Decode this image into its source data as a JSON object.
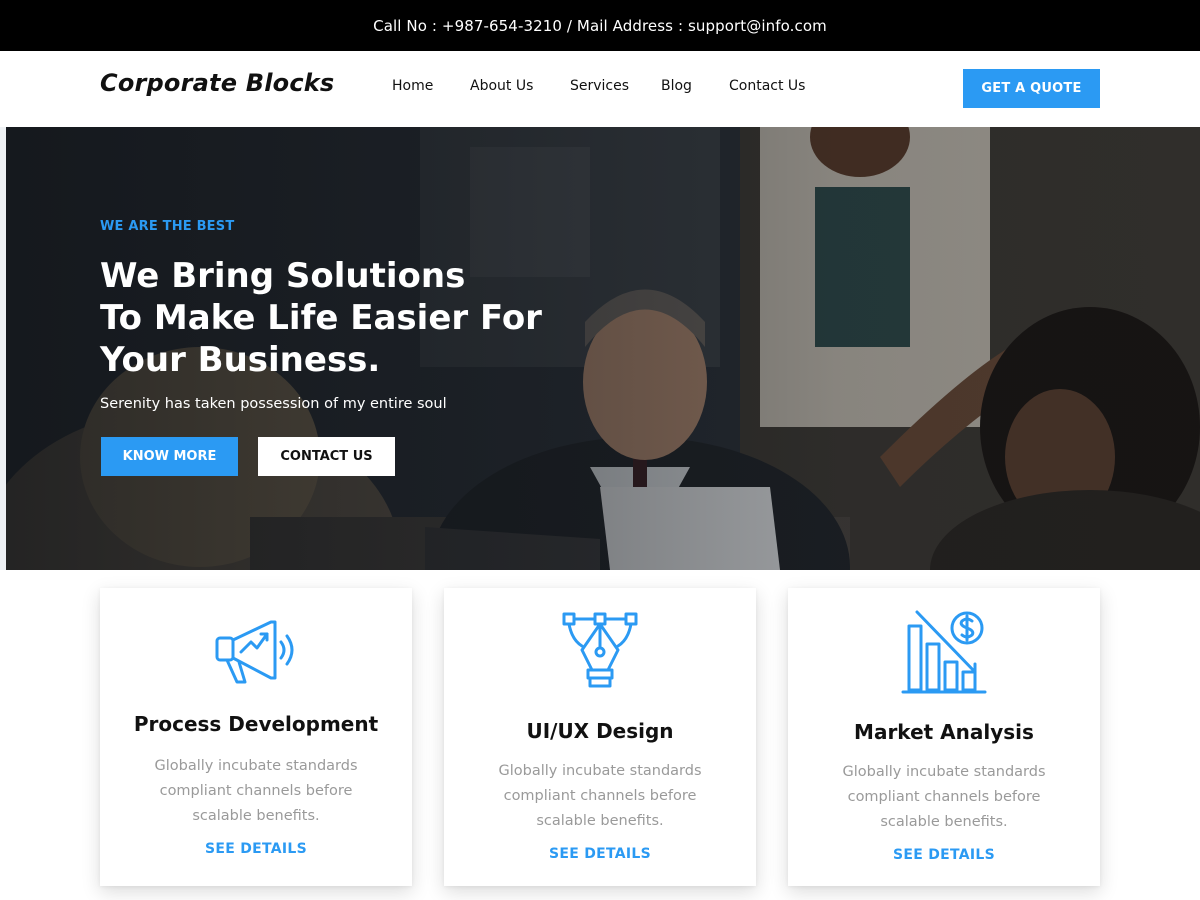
{
  "topbar": {
    "contact_text": "Call No : +987-654-3210 / Mail Address : support@info.com"
  },
  "header": {
    "logo": "Corporate Blocks",
    "nav": [
      "Home",
      "About Us",
      "Services",
      "Blog",
      "Contact Us"
    ],
    "cta": "GET A QUOTE"
  },
  "hero": {
    "kicker": "WE ARE THE BEST",
    "headline_lines": [
      "We Bring Solutions",
      "To Make Life Easier For",
      "Your Business."
    ],
    "subline": "Serenity has taken possession of my entire soul",
    "primary_button": "KNOW MORE",
    "secondary_button": "CONTACT US"
  },
  "cards": [
    {
      "icon": "megaphone-growth-icon",
      "title": "Process Development",
      "desc": "Globally incubate standards compliant channels before scalable benefits.",
      "link": "SEE DETAILS"
    },
    {
      "icon": "pen-tool-bezier-icon",
      "title": "UI/UX Design",
      "desc": "Globally incubate standards compliant channels before scalable benefits.",
      "link": "SEE DETAILS"
    },
    {
      "icon": "declining-chart-dollar-icon",
      "title": "Market Analysis",
      "desc": "Globally incubate standards compliant channels before scalable benefits.",
      "link": "SEE DETAILS"
    }
  ],
  "colors": {
    "accent": "#2b9af3",
    "topbar_bg": "#000000",
    "hero_overlay": "#0f1216",
    "card_text_muted": "#9a9a9a"
  }
}
